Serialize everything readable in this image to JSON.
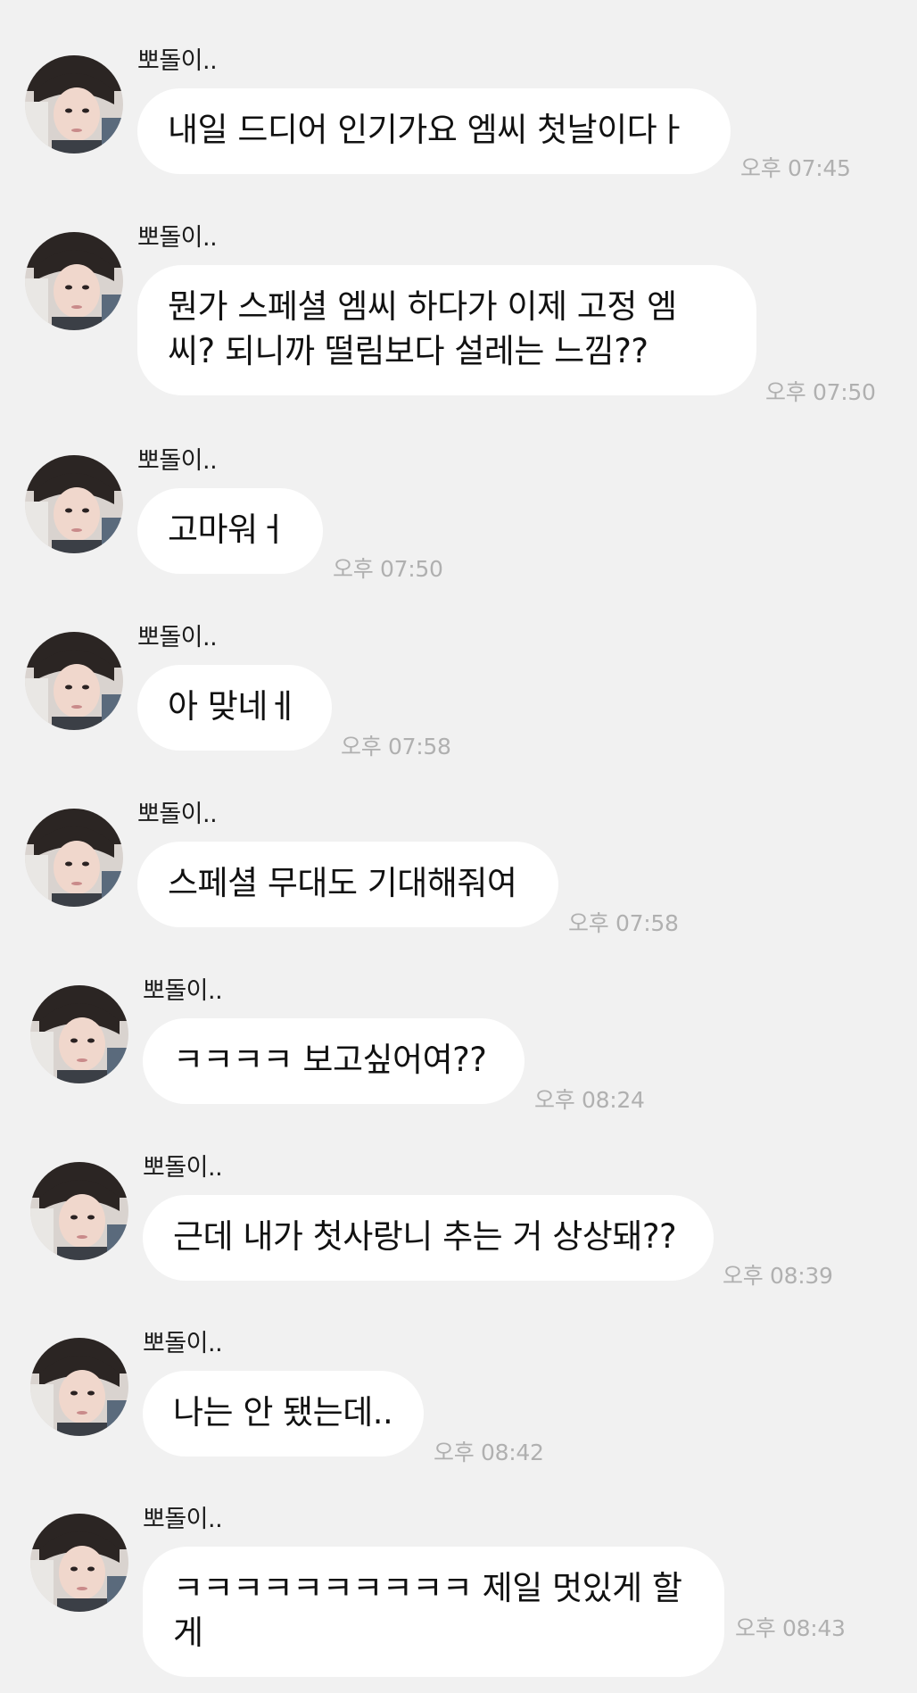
{
  "sender_name": "뽀돌이..",
  "colors": {
    "background": "#f1f1f1",
    "bubble": "#ffffff",
    "time_text": "#b0b0b0",
    "message_text": "#111111"
  },
  "messages": [
    {
      "text": "내일 드디어 인기가요 엠씨 첫날이다ㅏ",
      "time": "오후 07:45"
    },
    {
      "text": "뭔가 스페셜 엠씨 하다가 이제 고정 엠\n씨? 되니까 떨림보다 설레는 느낌??",
      "time": "오후 07:50"
    },
    {
      "text": "고마워ㅓ",
      "time": "오후 07:50"
    },
    {
      "text": "아 맞네ㅔ",
      "time": "오후 07:58"
    },
    {
      "text": "스페셜 무대도 기대해줘여",
      "time": "오후 07:58"
    },
    {
      "text": "ㅋㅋㅋㅋ 보고싶어여??",
      "time": "오후 08:24"
    },
    {
      "text": "근데 내가 첫사랑니 추는 거 상상돼??",
      "time": "오후 08:39"
    },
    {
      "text": "나는 안 됐는데..",
      "time": "오후 08:42"
    },
    {
      "text": "ㅋㅋㅋㅋㅋㅋㅋㅋㅋㅋ 제일 멋있게 할게",
      "time": "오후 08:43"
    }
  ]
}
